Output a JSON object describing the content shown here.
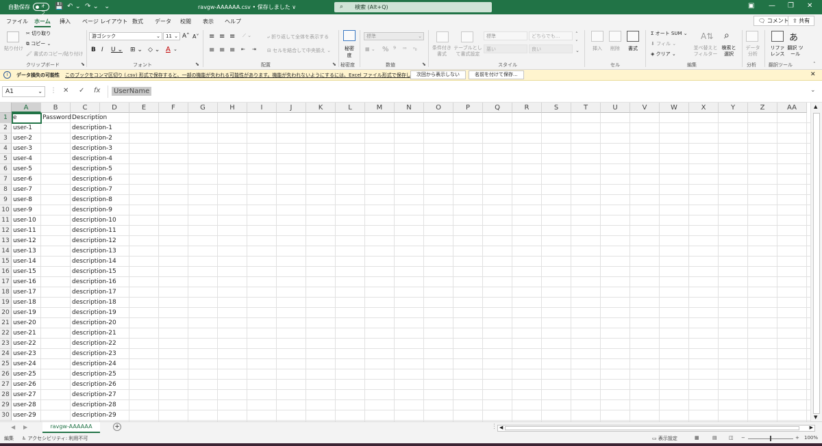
{
  "titlebar": {
    "autosave_label": "自動保存",
    "autosave_state": "オフ",
    "doc_title": "ravgw-AAAAAA.csv • 保存しました ∨",
    "search_placeholder": "検索 (Alt+Q)"
  },
  "menu": {
    "tabs": [
      "ファイル",
      "ホーム",
      "挿入",
      "ページ レイアウト",
      "数式",
      "データ",
      "校閲",
      "表示",
      "ヘルプ"
    ],
    "comment_label": "コメント",
    "share_label": "共有"
  },
  "ribbon": {
    "paste": "貼り付け",
    "cut": "切り取り",
    "copy": "コピー",
    "format_painter": "書式のコピー/貼り付け",
    "font_name": "游ゴシック",
    "font_size": "11",
    "wrap_text": "折り返して全体を表示する",
    "merge_center": "セルを結合して中央揃え",
    "sensitivity": "秘密度",
    "number_format": "標準",
    "conditional": "条件付き書式",
    "as_table": "テーブルとして書式設定",
    "style_normal": "標準",
    "style_neutral": "どちらでも...",
    "style_bad": "悪い",
    "style_good": "良い",
    "insert": "挿入",
    "delete": "削除",
    "format": "書式",
    "autosum": "オート SUM",
    "fill": "フィル",
    "clear": "クリア",
    "sort_filter": "並べ替えと フィルター",
    "find_select": "検索と 選択",
    "analyze": "データ 分析",
    "refresh": "リファ レンス",
    "translate": "翻訳 ツール",
    "groups": {
      "clipboard": "クリップボード",
      "font": "フォント",
      "alignment": "配置",
      "sensitivity": "秘密度",
      "number": "数値",
      "styles": "スタイル",
      "cells": "セル",
      "editing": "編集",
      "analysis": "分析",
      "translator": "翻訳ツール"
    }
  },
  "message_bar": {
    "title": "データ損失の可能性",
    "text": "このブックをコンマ区切り (.csv) 形式で保存すると、一部の機能が失われる可能性があります。機能が失われないようにするには、Excel ファイル形式で保存してください。",
    "dont_show": "次回から表示しない",
    "save_as": "名前を付けて保存..."
  },
  "formula_bar": {
    "name_box": "A1",
    "formula": "UserName"
  },
  "grid": {
    "columns": [
      "A",
      "B",
      "C",
      "D",
      "E",
      "F",
      "G",
      "H",
      "I",
      "J",
      "K",
      "L",
      "M",
      "N",
      "O",
      "P",
      "Q",
      "R",
      "S",
      "T",
      "U",
      "V",
      "W",
      "X",
      "Y",
      "Z",
      "AA"
    ],
    "header_row": [
      "e",
      "Password",
      "Description"
    ],
    "rows": [
      [
        "user-1",
        "",
        "description-1"
      ],
      [
        "user-2",
        "",
        "description-2"
      ],
      [
        "user-3",
        "",
        "description-3"
      ],
      [
        "user-4",
        "",
        "description-4"
      ],
      [
        "user-5",
        "",
        "description-5"
      ],
      [
        "user-6",
        "",
        "description-6"
      ],
      [
        "user-7",
        "",
        "description-7"
      ],
      [
        "user-8",
        "",
        "description-8"
      ],
      [
        "user-9",
        "",
        "description-9"
      ],
      [
        "user-10",
        "",
        "description-10"
      ],
      [
        "user-11",
        "",
        "description-11"
      ],
      [
        "user-12",
        "",
        "description-12"
      ],
      [
        "user-13",
        "",
        "description-13"
      ],
      [
        "user-14",
        "",
        "description-14"
      ],
      [
        "user-15",
        "",
        "description-15"
      ],
      [
        "user-16",
        "",
        "description-16"
      ],
      [
        "user-17",
        "",
        "description-17"
      ],
      [
        "user-18",
        "",
        "description-18"
      ],
      [
        "user-19",
        "",
        "description-19"
      ],
      [
        "user-20",
        "",
        "description-20"
      ],
      [
        "user-21",
        "",
        "description-21"
      ],
      [
        "user-22",
        "",
        "description-22"
      ],
      [
        "user-23",
        "",
        "description-23"
      ],
      [
        "user-24",
        "",
        "description-24"
      ],
      [
        "user-25",
        "",
        "description-25"
      ],
      [
        "user-26",
        "",
        "description-26"
      ],
      [
        "user-27",
        "",
        "description-27"
      ],
      [
        "user-28",
        "",
        "description-28"
      ],
      [
        "user-29",
        "",
        "description-29"
      ]
    ]
  },
  "sheet_tab": "ravgw-AAAAAA",
  "status": {
    "mode": "編集",
    "accessibility": "アクセシビリティ: 利用不可",
    "display_settings": "表示設定",
    "zoom": "100%"
  }
}
